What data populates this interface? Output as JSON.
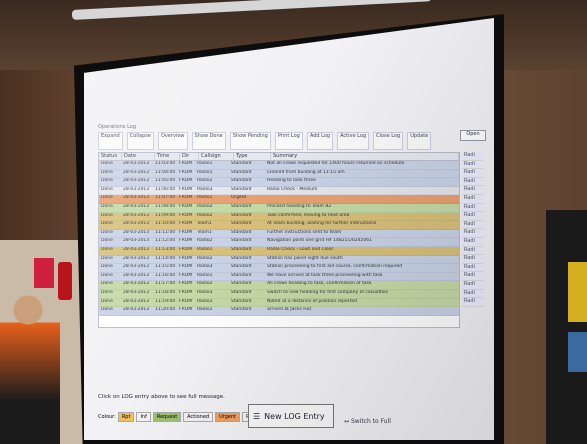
{
  "app": {
    "title": "Operations Log",
    "open_button": "Open",
    "toolbar": [
      "Expand",
      "Collapse",
      "Overview",
      "Show Done",
      "Show Pending",
      "Print Log",
      "Add Log",
      "Active Log",
      "Close Log",
      "Update"
    ],
    "columns": [
      "Status",
      "Date",
      "Time",
      "Dir",
      "Callsign",
      "Type",
      "Summary"
    ],
    "side_label": "Radi",
    "message_hint": "Click on LOG entry above to see full message.",
    "filters_label": "Colour:",
    "filters": [
      "Rpt",
      "Inf",
      "Request",
      "Actioned",
      "Urgent",
      "Priority"
    ],
    "new_log_label": "New LOG Entry",
    "switch_label": "Switch to Full"
  },
  "colors": {
    "row_blue": "#c9d2e6",
    "row_green": "#c4d9a6",
    "row_orange": "#e8a070",
    "row_gold": "#d8c07a",
    "row_plain": "#e4e6ec",
    "filter_rpt": "#f0c060",
    "filter_request": "#9fc070",
    "filter_urgent": "#f0a060"
  },
  "rows": [
    {
      "status": "Done",
      "date": "28-03-2013",
      "time": "11:03:00",
      "dir": "FROM",
      "callsign": "Radio1",
      "type": "Standard",
      "summary": "Not all crews requested for 1400 hours returned on schedule",
      "color": "row_blue"
    },
    {
      "status": "Done",
      "date": "28-03-2013",
      "time": "11:04:00",
      "dir": "FROM",
      "callsign": "Radio1",
      "type": "Standard",
      "summary": "Cleared from building at 11:15 am",
      "color": "row_blue"
    },
    {
      "status": "Done",
      "date": "28-03-2013",
      "time": "11:05:00",
      "dir": "FROM",
      "callsign": "Radio2",
      "type": "Standard",
      "summary": "Heading to task three",
      "color": "row_blue"
    },
    {
      "status": "Done",
      "date": "28-03-2013",
      "time": "11:06:00",
      "dir": "FROM",
      "callsign": "Radio3",
      "type": "Standard",
      "summary": "Radio Check - Medium",
      "color": "row_plain"
    },
    {
      "status": "Done",
      "date": "28-03-2013",
      "time": "11:07:00",
      "dir": "FROM",
      "callsign": "Radio1",
      "type": "Urgent",
      "summary": "",
      "color": "row_orange"
    },
    {
      "status": "Done",
      "date": "28-03-2013",
      "time": "11:08:00",
      "dir": "FROM",
      "callsign": "Radio2",
      "type": "Standard",
      "summary": "Proceed heading to Team B2",
      "color": "row_green"
    },
    {
      "status": "Done",
      "date": "28-03-2013",
      "time": "11:09:00",
      "dir": "FROM",
      "callsign": "Radio2",
      "type": "Standard",
      "summary": "Task confirmed, moving to next area",
      "color": "row_gold"
    },
    {
      "status": "Done",
      "date": "28-03-2013",
      "time": "11:10:00",
      "dir": "FROM",
      "callsign": "Team1",
      "type": "Standard",
      "summary": "At Team building, waiting for further instructions",
      "color": "row_gold"
    },
    {
      "status": "Done",
      "date": "28-03-2013",
      "time": "11:11:00",
      "dir": "FROM",
      "callsign": "Team1",
      "type": "Standard",
      "summary": "Further instructions sent to team",
      "color": "row_blue"
    },
    {
      "status": "Done",
      "date": "28-03-2013",
      "time": "11:12:00",
      "dir": "FROM",
      "callsign": "Radio2",
      "type": "Standard",
      "summary": "Navigation point one grid ref 148251/0245061",
      "color": "row_blue"
    },
    {
      "status": "Done",
      "date": "28-03-2013",
      "time": "11:13:00",
      "dir": "FROM",
      "callsign": "Radio1",
      "type": "Standard",
      "summary": "Radio Check - Loud and Clear",
      "color": "row_gold"
    },
    {
      "status": "Done",
      "date": "28-03-2013",
      "time": "11:14:00",
      "dir": "FROM",
      "callsign": "Radio2",
      "type": "Standard",
      "summary": "Station has panel sight due south",
      "color": "row_blue"
    },
    {
      "status": "Done",
      "date": "28-03-2013",
      "time": "11:15:00",
      "dir": "FROM",
      "callsign": "Radio3",
      "type": "Standard",
      "summary": "Station proceeding to first aid course, confirmation required",
      "color": "row_blue"
    },
    {
      "status": "Done",
      "date": "28-03-2013",
      "time": "11:16:00",
      "dir": "FROM",
      "callsign": "Radio1",
      "type": "Standard",
      "summary": "We have arrived at task three proceeding with task",
      "color": "row_blue"
    },
    {
      "status": "Done",
      "date": "28-03-2013",
      "time": "11:17:00",
      "dir": "FROM",
      "callsign": "Radio2",
      "type": "Standard",
      "summary": "All crews heading to task, confirmation of task",
      "color": "row_green"
    },
    {
      "status": "Done",
      "date": "28-03-2013",
      "time": "11:18:00",
      "dir": "FROM",
      "callsign": "Radio3",
      "type": "Standard",
      "summary": "Switch to new heading for first company of casualties",
      "color": "row_green"
    },
    {
      "status": "Done",
      "date": "28-03-2013",
      "time": "11:19:00",
      "dir": "FROM",
      "callsign": "Radio1",
      "type": "Standard",
      "summary": "Noted at a distance of position reported",
      "color": "row_green"
    },
    {
      "status": "Done",
      "date": "28-03-2013",
      "time": "11:20:00",
      "dir": "FROM",
      "callsign": "Radio1",
      "type": "Standard",
      "summary": "arrived at Jacks Hut",
      "color": "row_blue"
    }
  ]
}
